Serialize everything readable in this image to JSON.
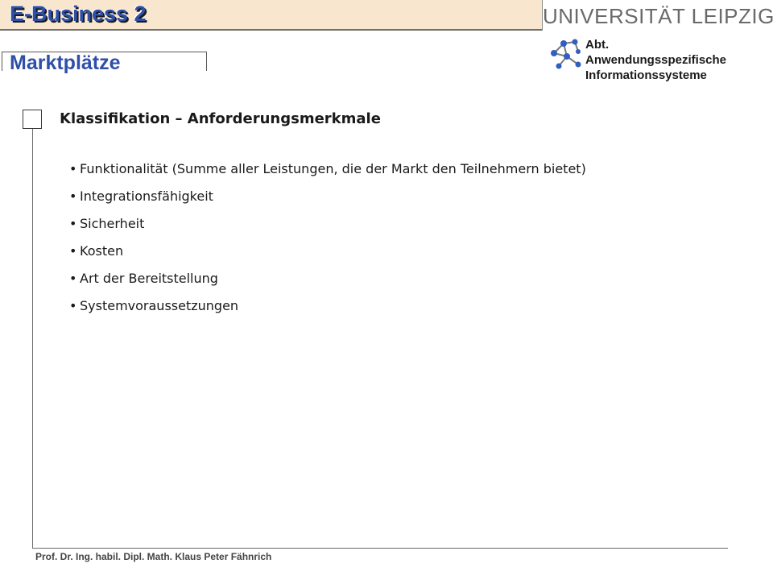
{
  "header": {
    "course_title": "E-Business 2",
    "university": "UNIVERSITÄT LEIPZIG"
  },
  "section": {
    "title": "Marktplätze"
  },
  "department": {
    "line1": "Abt.",
    "line2": "Anwendungsspezifische",
    "line3": "Informationssysteme",
    "icon": "network-icon"
  },
  "slide": {
    "heading": "Klassifikation – Anforderungsmerkmale",
    "bullet_symbol": "•",
    "bullets": [
      "Funktionalität (Summe aller Leistungen, die der Markt den Teilnehmern bietet)",
      "Integrationsfähigkeit",
      "Sicherheit",
      "Kosten",
      "Art der Bereitstellung",
      "Systemvoraussetzungen"
    ]
  },
  "footer": {
    "author": "Prof. Dr. Ing. habil. Dipl. Math. Klaus Peter Fähnrich"
  },
  "colors": {
    "title_blue": "#2f4fa8",
    "header_bg": "#f8e6cf",
    "logo_gray": "#6a6a6a"
  }
}
